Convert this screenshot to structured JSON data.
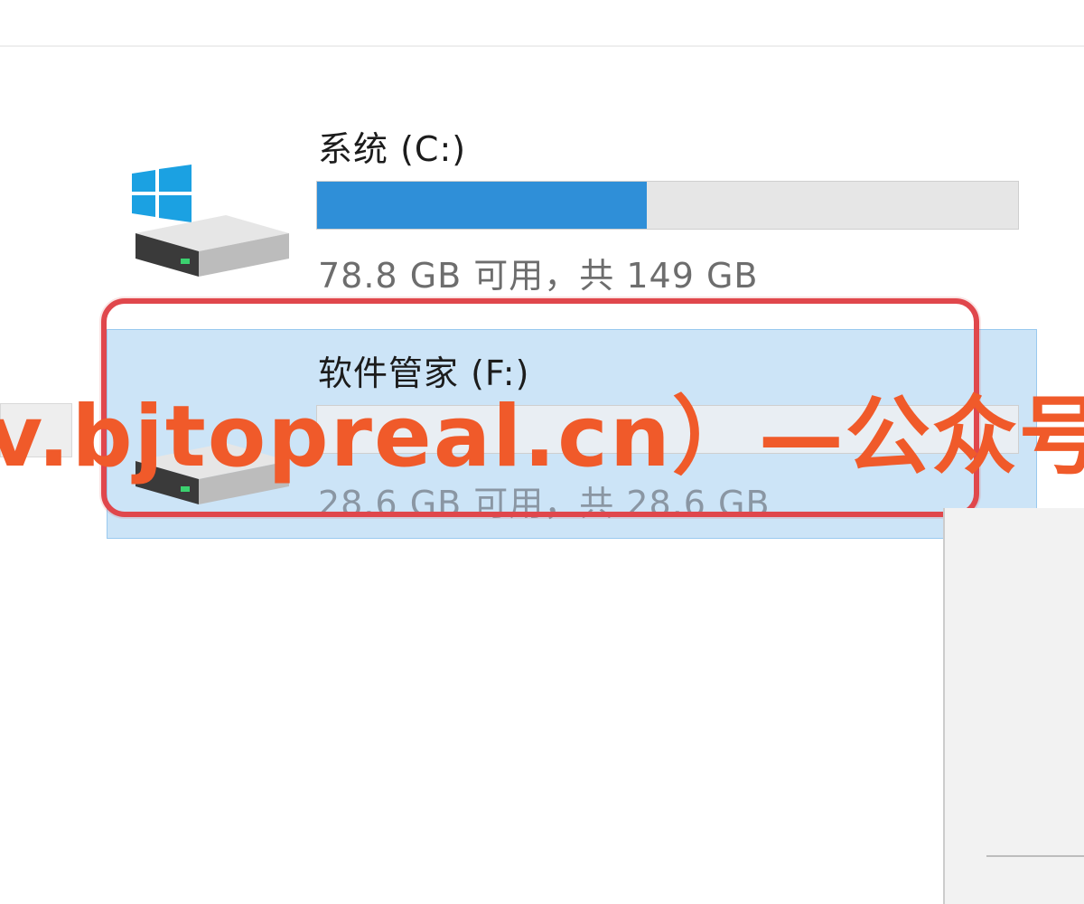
{
  "drives": [
    {
      "name": "系统 (C:)",
      "space_text": "78.8 GB 可用，共 149 GB",
      "used_fraction": 0.47,
      "icon": "windows-drive-icon"
    },
    {
      "name": "软件管家 (F:)",
      "space_text": "28.6 GB 可用，共 28.6 GB",
      "used_fraction": 0.0,
      "icon": "hard-drive-icon"
    }
  ],
  "watermark": "v.bjtopreal.cn）—公众号和融媒",
  "colors": {
    "bar_fill": "#2f8fd8",
    "selection": "#cce4f7",
    "highlight_frame": "#e0474c",
    "watermark": "#f05a2a"
  }
}
